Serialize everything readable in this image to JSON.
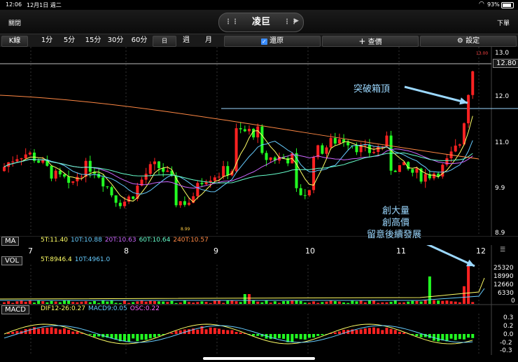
{
  "status": {
    "time": "12:06",
    "date": "12月1日 週二",
    "battery": "93%"
  },
  "header": {
    "close": "關閉",
    "title": "凌巨",
    "next": "下單"
  },
  "toolbar": {
    "kline": "K線",
    "periods": [
      "1分",
      "5分",
      "15分",
      "30分",
      "60分",
      "日",
      "週",
      "月"
    ],
    "restore": "還原",
    "query": "查價",
    "settings": "設定"
  },
  "price_axis": {
    "ticks": [
      "13.0",
      "12.0",
      "11.0",
      "9.9",
      "8.9"
    ],
    "current": "12.80",
    "high_label": "13.00",
    "low_label": "8.99"
  },
  "ma_legend": {
    "name": "MA",
    "items": [
      {
        "label": "5T:11.40",
        "color": "#ffff66"
      },
      {
        "label": "10T:10.88",
        "color": "#66ccff"
      },
      {
        "label": "20T:10.63",
        "color": "#cc66ff"
      },
      {
        "label": "60T:10.64",
        "color": "#66ffcc"
      },
      {
        "label": "240T:10.57",
        "color": "#ff8844"
      }
    ]
  },
  "x_axis": {
    "labels": [
      "7",
      "8",
      "9",
      "10",
      "11",
      "12"
    ]
  },
  "vol_legend": {
    "name": "VOL",
    "items": [
      {
        "label": "5T:8946.4",
        "color": "#ffff66"
      },
      {
        "label": "10T:4961.0",
        "color": "#66ccff"
      }
    ]
  },
  "vol_axis": {
    "ticks": [
      "25320",
      "18990",
      "12660",
      "6330",
      "0"
    ]
  },
  "macd_legend": {
    "name": "MACD",
    "items": [
      {
        "label": "DIF12-26:0.27",
        "color": "#ffff66"
      },
      {
        "label": "MACD9:0.05",
        "color": "#66ccff"
      },
      {
        "label": "OSC:0.22",
        "color": "#ff66ff"
      }
    ]
  },
  "macd_axis": {
    "ticks": [
      "0.3",
      "0.2",
      "0.0",
      "-0.2",
      "-0.3"
    ]
  },
  "annotations": {
    "breakout": "突破箱頂",
    "note1": "創大量",
    "note2": "創高價",
    "note3": "留意後續發展"
  },
  "colors": {
    "up": "#ff2222",
    "down": "#22ff22",
    "accent": "#9bd8ff"
  }
}
